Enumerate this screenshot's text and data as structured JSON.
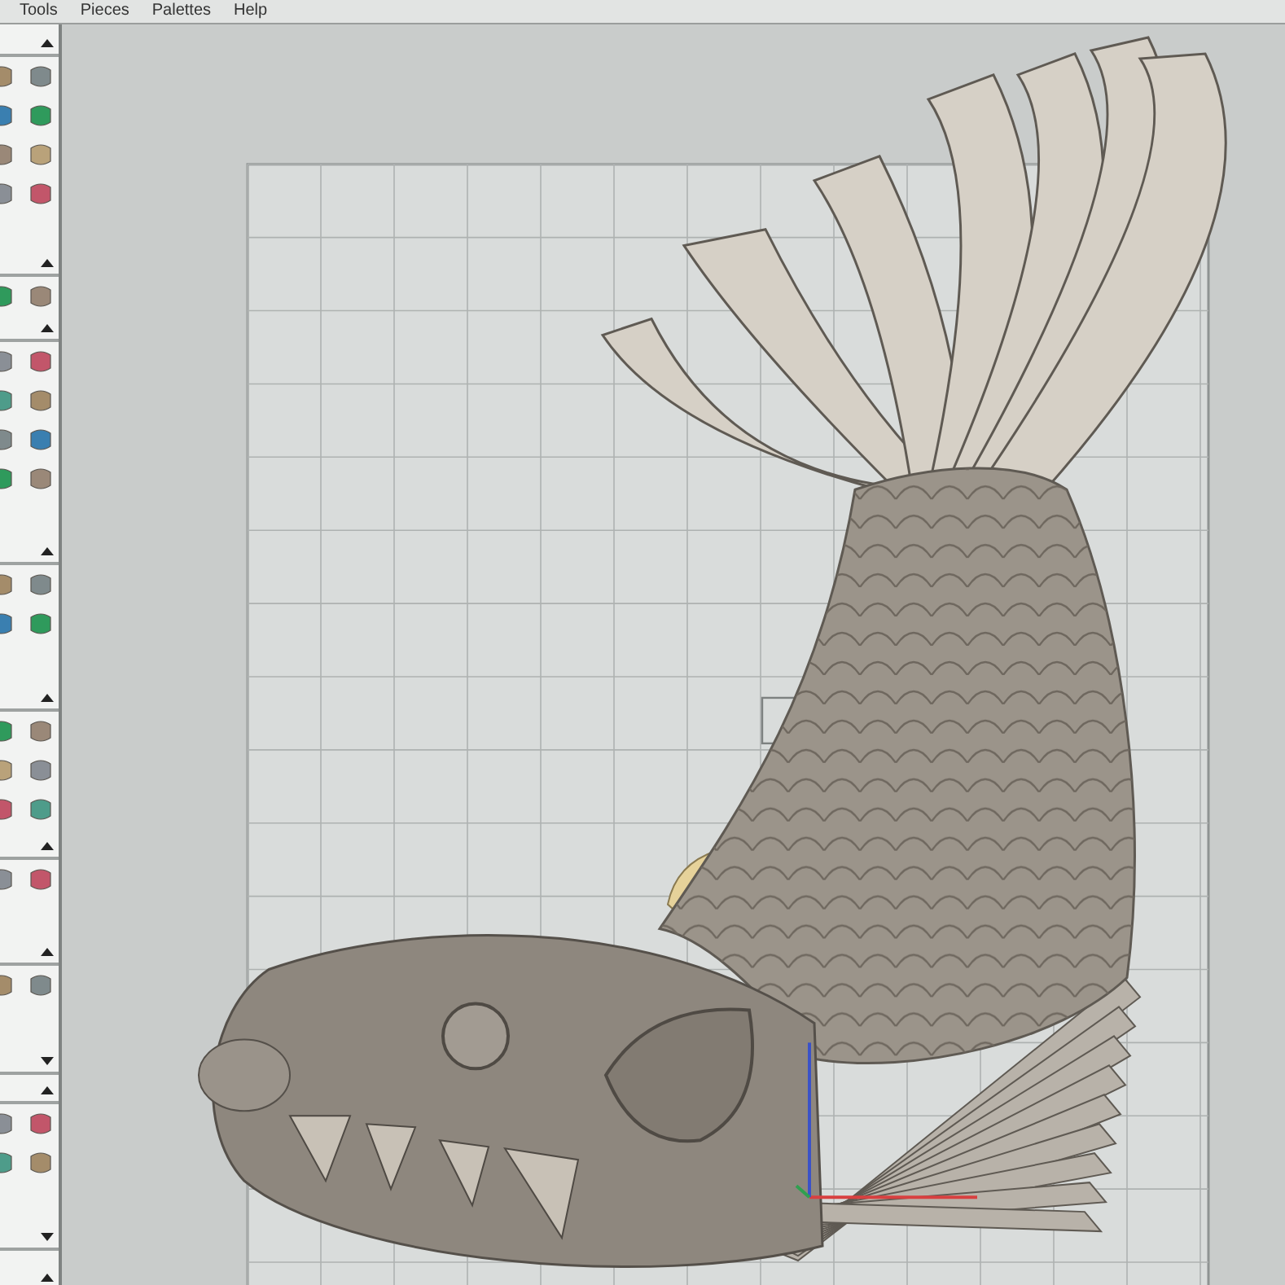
{
  "menu_bar": {
    "items": [
      {
        "label": "Tools"
      },
      {
        "label": "Pieces"
      },
      {
        "label": "Palettes"
      },
      {
        "label": "Help"
      }
    ]
  },
  "tool_palettes": [
    {
      "expanded": true
    },
    {
      "expanded": true
    },
    {
      "expanded": true
    },
    {
      "expanded": true
    },
    {
      "expanded": true
    },
    {
      "expanded": true
    },
    {
      "expanded": true
    },
    {
      "expanded": false
    },
    {
      "expanded": true
    },
    {
      "expanded": false
    },
    {
      "expanded": true
    }
  ]
}
